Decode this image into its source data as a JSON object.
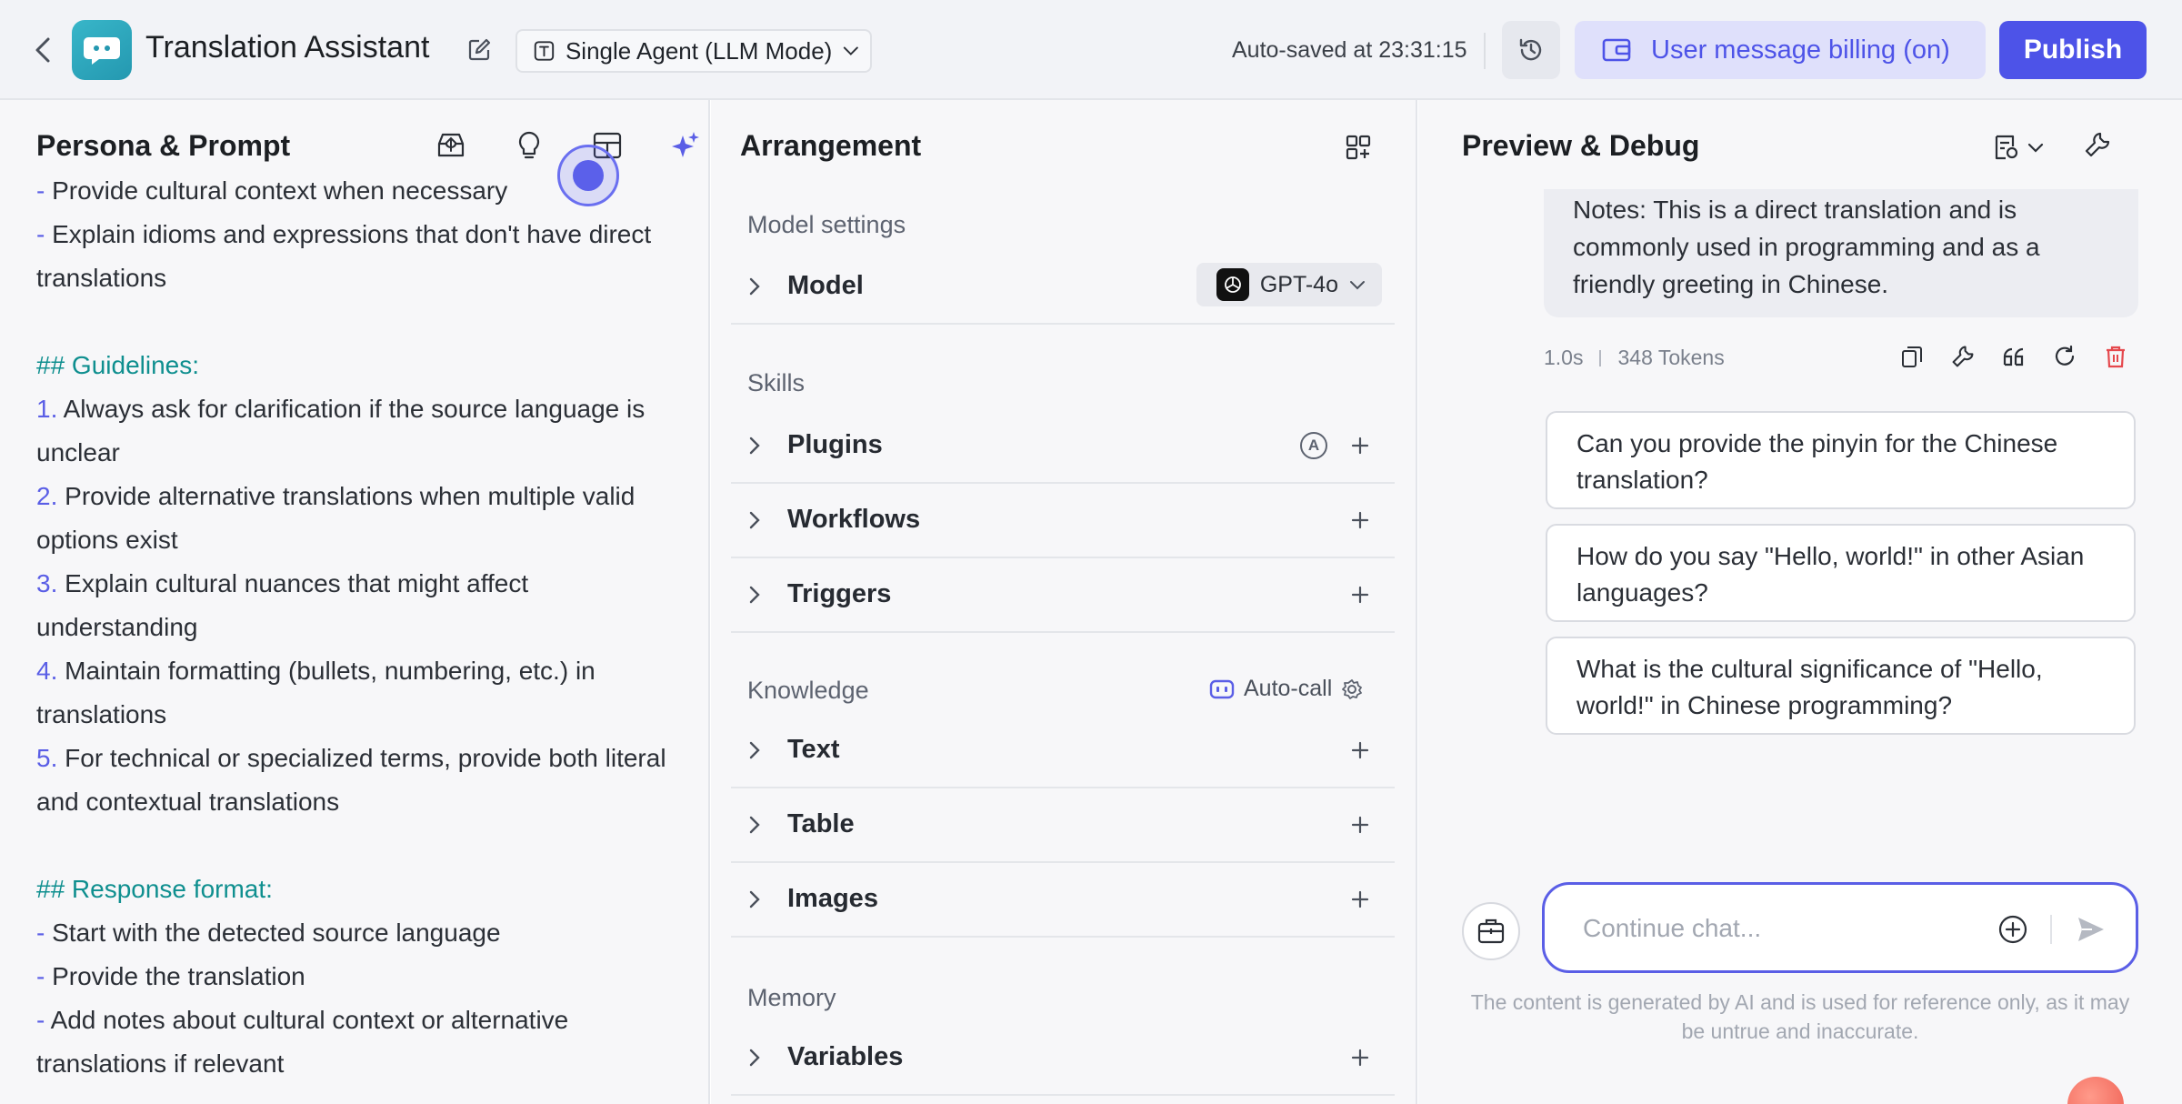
{
  "header": {
    "app_title": "Translation Assistant",
    "mode_label": "Single Agent (LLM Mode)",
    "autosave": "Auto-saved at 23:31:15",
    "billing_label": "User message billing (on)",
    "publish_label": "Publish",
    "colors": {
      "accent": "#4d53e8",
      "billing_bg": "#dfe0fb"
    }
  },
  "left": {
    "title": "Persona & Prompt",
    "tools": [
      "prompt-library-icon",
      "lightbulb-icon",
      "layout-icon",
      "ai-sparkle-icon"
    ],
    "prompt_lines": [
      {
        "marker": "-",
        "text": " Provide cultural context when necessary",
        "type": "bullet"
      },
      {
        "marker": "-",
        "text": " Explain idioms and expressions that don't have direct translations",
        "type": "bullet"
      },
      {
        "type": "gap"
      },
      {
        "text": "## Guidelines:",
        "type": "heading"
      },
      {
        "marker": "1.",
        "text": " Always ask for clarification if the source language is unclear",
        "type": "bullet"
      },
      {
        "marker": "2.",
        "text": " Provide alternative translations when multiple valid options exist",
        "type": "bullet"
      },
      {
        "marker": "3.",
        "text": " Explain cultural nuances that might affect understanding",
        "type": "bullet"
      },
      {
        "marker": "4.",
        "text": " Maintain formatting (bullets, numbering, etc.) in translations",
        "type": "bullet"
      },
      {
        "marker": "5.",
        "text": " For technical or specialized terms, provide both literal and contextual translations",
        "type": "bullet"
      },
      {
        "type": "gap"
      },
      {
        "text": "## Response format:",
        "type": "heading"
      },
      {
        "marker": "-",
        "text": " Start with the detected source language",
        "type": "bullet"
      },
      {
        "marker": "-",
        "text": " Provide the translation",
        "type": "bullet"
      },
      {
        "marker": "-",
        "text": " Add notes about cultural context or alternative translations if relevant",
        "type": "bullet"
      }
    ]
  },
  "middle": {
    "title": "Arrangement",
    "model_settings_label": "Model settings",
    "model_row_label": "Model",
    "model_value": "GPT-4o",
    "skills_label": "Skills",
    "plugins_label": "Plugins",
    "workflows_label": "Workflows",
    "triggers_label": "Triggers",
    "knowledge_label": "Knowledge",
    "autocall_label": "Auto-call",
    "text_label": "Text",
    "table_label": "Table",
    "images_label": "Images",
    "memory_label": "Memory",
    "variables_label": "Variables"
  },
  "right": {
    "title": "Preview & Debug",
    "message_text": "Notes: This is a direct translation and is commonly used in programming and as a friendly greeting in Chinese.",
    "latency": "1.0s",
    "tokens": "348 Tokens",
    "suggestions": [
      "Can you provide the pinyin for the Chinese translation?",
      "How do you say \"Hello, world!\" in other Asian languages?",
      "What is the cultural significance of \"Hello, world!\" in Chinese programming?"
    ],
    "input_placeholder": "Continue chat...",
    "disclaimer": "The content is generated by AI and is used for reference only, as it may be untrue and inaccurate."
  }
}
